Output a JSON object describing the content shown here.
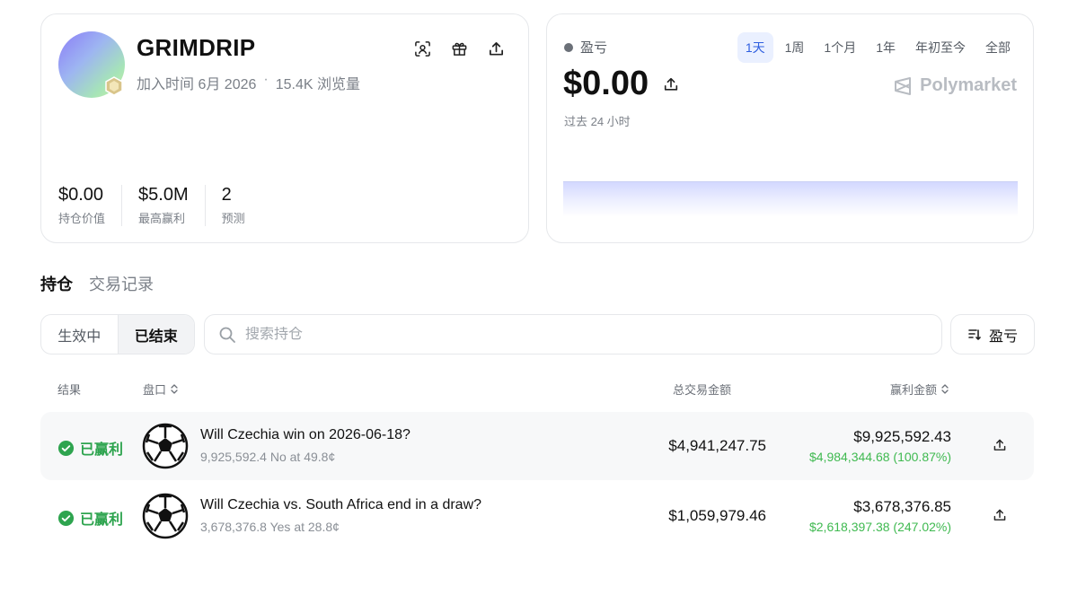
{
  "profile": {
    "username": "GRIMDRIP",
    "joined": "加入时间 6月 2026",
    "separator": "·",
    "views": "15.4K 浏览量",
    "stats": [
      {
        "value": "$0.00",
        "label": "持仓价值"
      },
      {
        "value": "$5.0M",
        "label": "最高赢利"
      },
      {
        "value": "2",
        "label": "预测"
      }
    ],
    "icons": [
      "scan-icon",
      "gift-icon",
      "share-icon"
    ]
  },
  "pnl": {
    "title": "盈亏",
    "value": "$0.00",
    "subtitle": "过去 24 小时",
    "brand": "Polymarket",
    "ranges": [
      "1天",
      "1周",
      "1个月",
      "1年",
      "年初至今",
      "全部"
    ],
    "active_range": "1天"
  },
  "tabs": [
    "持仓",
    "交易记录"
  ],
  "active_tab": "持仓",
  "filters": {
    "active_label": "生效中",
    "closed_label": "已结束",
    "selected": "已结束"
  },
  "search": {
    "placeholder": "搜索持仓",
    "value": ""
  },
  "sort": {
    "label": "盈亏"
  },
  "table": {
    "headers": {
      "result": "结果",
      "market": "盘口",
      "volume": "总交易金额",
      "pnl": "赢利金额"
    },
    "rows": [
      {
        "result": "已赢利",
        "title": "Will Czechia win on 2026-06-18?",
        "subtitle": "9,925,592.4 No at 49.8¢",
        "volume": "$4,941,247.75",
        "amount": "$9,925,592.43",
        "profit": "$4,984,344.68 (100.87%)"
      },
      {
        "result": "已赢利",
        "title": "Will Czechia vs. South Africa end in a draw?",
        "subtitle": "3,678,376.8 Yes at 28.8¢",
        "volume": "$1,059,979.46",
        "amount": "$3,678,376.85",
        "profit": "$2,618,397.38 (247.02%)"
      }
    ]
  },
  "colors": {
    "accent": "#2f5fe0",
    "win": "#2ea44f",
    "profit": "#3fb950",
    "muted": "#7b8088"
  }
}
